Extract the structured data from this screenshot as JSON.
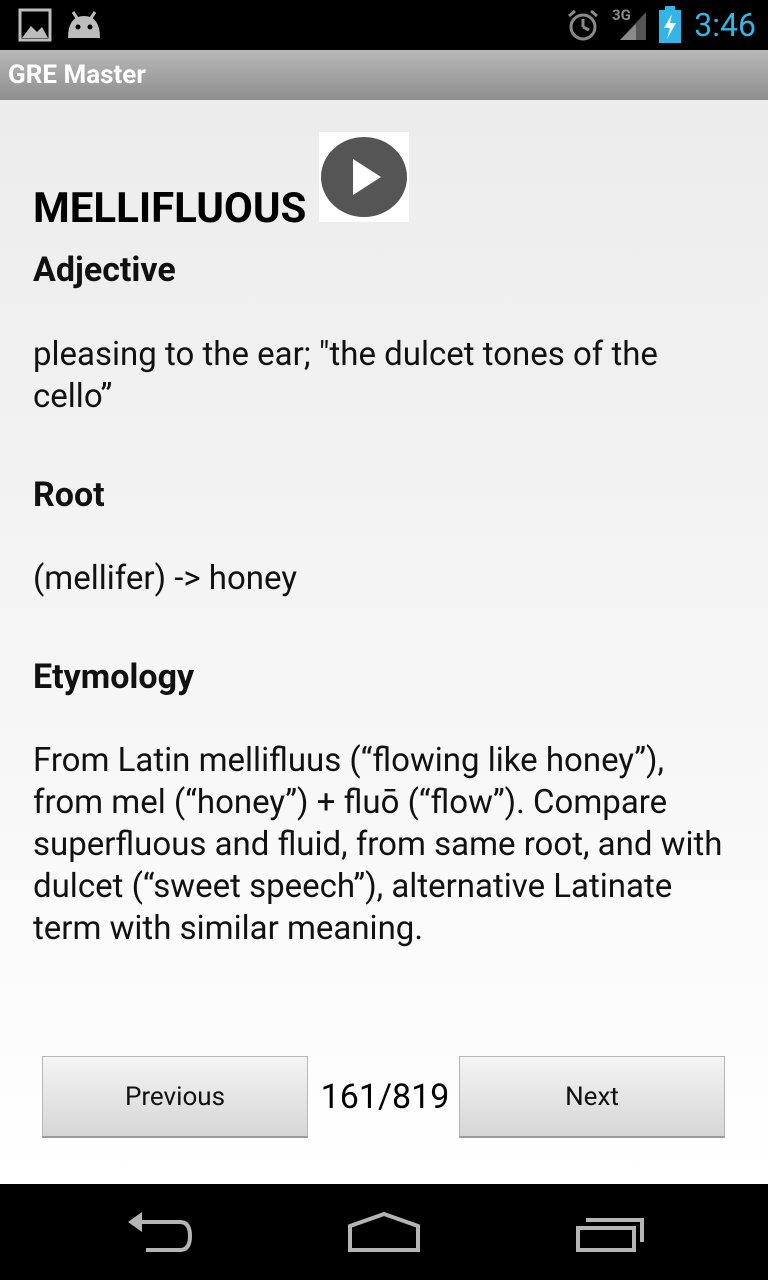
{
  "status_bar": {
    "time": "3:46",
    "network": "3G",
    "icons": [
      "gallery-icon",
      "android-icon",
      "alarm-icon",
      "signal-icon",
      "battery-charging-icon"
    ]
  },
  "app": {
    "title": "GRE Master"
  },
  "card": {
    "word": "MELLIFLUOUS",
    "part_of_speech": "Adjective",
    "definition": "pleasing to the ear; \"the dulcet tones of the cello”",
    "root_heading": "Root",
    "root": "(mellifer) -> honey",
    "etymology_heading": "Etymology",
    "etymology": "From Latin mellifluus (“flowing like honey”), from mel (“honey”) + fluō (“flow”). Compare superfluous and fluid, from same root, and with dulcet (“sweet speech”), alternative Latinate term with similar meaning."
  },
  "pager": {
    "previous_label": "Previous",
    "counter": "161/819",
    "next_label": "Next"
  },
  "nav_bar": {
    "icons": [
      "back-icon",
      "home-icon",
      "recent-apps-icon"
    ]
  },
  "colors": {
    "clock": "#33b5e5",
    "action_bar": "#a4a4a4"
  }
}
